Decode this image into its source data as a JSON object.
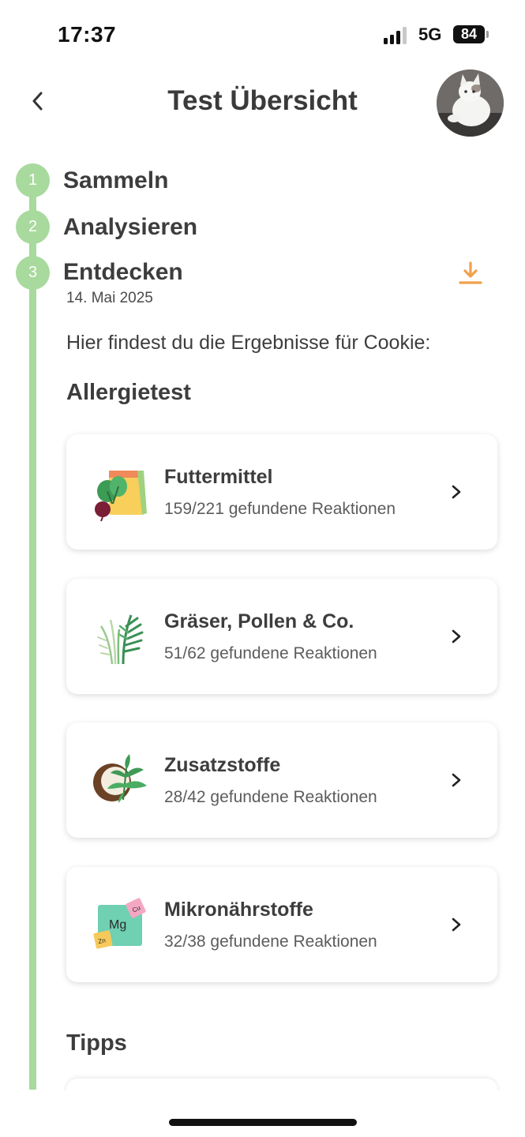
{
  "status_bar": {
    "time": "17:37",
    "network": "5G",
    "battery": "84"
  },
  "header": {
    "title": "Test Übersicht",
    "back_icon": "chevron-left-icon",
    "avatar": "cat-avatar"
  },
  "steps": [
    {
      "number": "1",
      "label": "Sammeln"
    },
    {
      "number": "2",
      "label": "Analysieren"
    },
    {
      "number": "3",
      "label": "Entdecken",
      "date": "14. Mai 2025"
    }
  ],
  "intro_text": "Hier findest du die Ergebnisse für Cookie:",
  "allergy_section": {
    "title": "Allergietest",
    "cards": [
      {
        "title": "Futtermittel",
        "subtitle": "159/221 gefundene Reaktionen",
        "icon": "food-bag-icon"
      },
      {
        "title": "Gräser, Pollen & Co.",
        "subtitle": "51/62 gefundene Reaktionen",
        "icon": "grass-icon"
      },
      {
        "title": "Zusatzstoffe",
        "subtitle": "28/42 gefundene Reaktionen",
        "icon": "coconut-leaf-icon"
      },
      {
        "title": "Mikronährstoffe",
        "subtitle": "32/38 gefundene Reaktionen",
        "icon": "mineral-blocks-icon",
        "icon_labels": [
          "Mg",
          "Cu",
          "Zn"
        ]
      }
    ]
  },
  "tips_section": {
    "title": "Tipps"
  },
  "colors": {
    "timeline": "#a8d99d",
    "accent_orange": "#f0a04b",
    "text": "#3d3d3d"
  }
}
